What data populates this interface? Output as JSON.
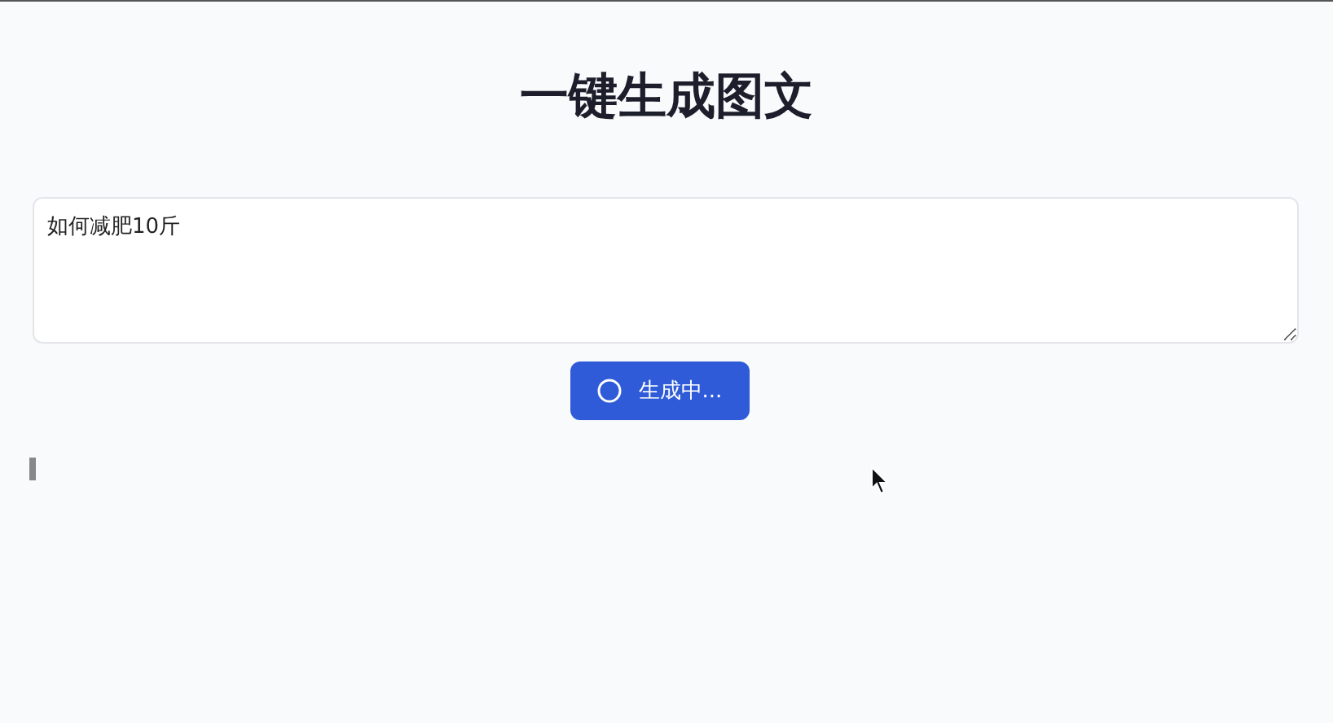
{
  "title": "一键生成图文",
  "prompt": {
    "value": "如何减肥10斤"
  },
  "generate_button": {
    "label": "生成中...",
    "loading": true
  }
}
